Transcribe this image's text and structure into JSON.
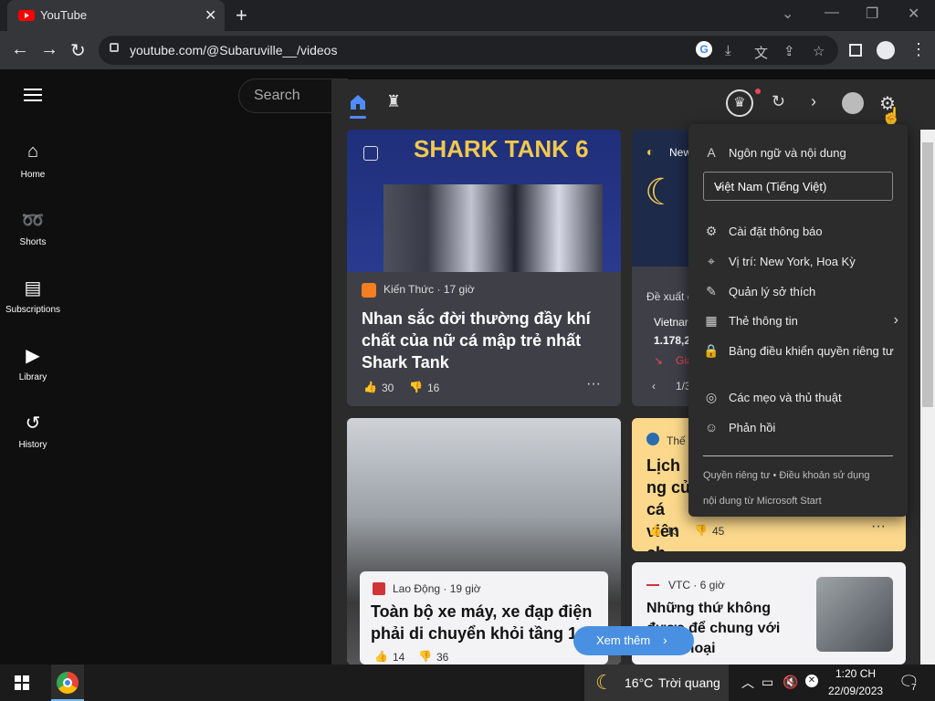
{
  "browser": {
    "tab_title": "YouTube",
    "url": "youtube.com/@Subaruville__/videos"
  },
  "youtube": {
    "search_placeholder": "Search",
    "sidebar": [
      {
        "icon": "home-icon",
        "label": "Home"
      },
      {
        "icon": "shorts-icon",
        "label": "Shorts"
      },
      {
        "icon": "subscriptions-icon",
        "label": "Subscriptions"
      },
      {
        "icon": "library-icon",
        "label": "Library"
      },
      {
        "icon": "history-icon",
        "label": "History"
      }
    ]
  },
  "widgets": {
    "cards": [
      {
        "source": "Kiến Thức · 17 giờ",
        "title": "Nhan sắc đời thường đầy khí chất của nữ cá mập trẻ nhất Shark Tank",
        "likes": "30",
        "dislikes": "16",
        "image_text": "SHARK TANK 6"
      },
      {
        "source": "Lao Động · 19 giờ",
        "title": "Toàn bộ xe máy, xe đạp điện phải di chuyển khỏi tầng 1",
        "likes": "14",
        "dislikes": "36"
      },
      {
        "source": "Thế",
        "title": "Lịch ng của cá viên ch",
        "likes": "13",
        "dislikes": "45"
      },
      {
        "source": "VTC · 6 giờ",
        "title": "Những thứ không được để chung với điện thoại",
        "title_tail": "g"
      }
    ],
    "weather_card": {
      "label": "New",
      "suggest": "Đề xuất c",
      "stock_name": "Vietnar",
      "stock_value": "1.178,27",
      "stock_change": "Giả",
      "pager": "1/3"
    },
    "see_more": "Xem thêm"
  },
  "settings_menu": {
    "header": "Ngôn ngữ và nội dung",
    "language": "Việt Nam (Tiếng Việt)",
    "items": [
      {
        "icon": "gear-icon",
        "label": "Cài đặt thông báo"
      },
      {
        "icon": "location-icon",
        "label": "Vị trí: New York, Hoa Kỳ"
      },
      {
        "icon": "pencil-icon",
        "label": "Quản lý sở thích"
      },
      {
        "icon": "grid-icon",
        "label": "Thẻ thông tin"
      },
      {
        "icon": "lock-icon",
        "label": "Bảng điều khiển quyền riêng tư"
      },
      {
        "icon": "lightbulb-icon",
        "label": "Các mẹo và thủ thuật"
      },
      {
        "icon": "feedback-icon",
        "label": "Phản hồi"
      }
    ],
    "footer_links": "Quyền riêng tư • Điều khoản sử dụng",
    "footer_note": "nội dung từ Microsoft Start"
  },
  "taskbar": {
    "temperature": "16°C",
    "weather": "Trời quang",
    "time": "1:20 CH",
    "date": "22/09/2023",
    "notification_count": "7"
  },
  "colors": {
    "accent": "#4f8cff",
    "youtube_red": "#ff0000",
    "see_more": "#4a90e2"
  }
}
